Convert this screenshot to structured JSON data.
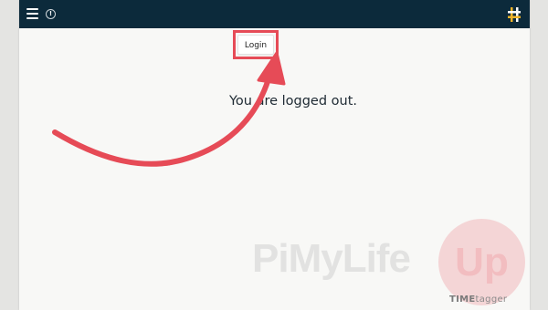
{
  "app": {
    "info_glyph": "!"
  },
  "header": {
    "menu_icon": "hamburger-menu-icon",
    "info_icon": "info-icon",
    "logo_icon": "timetagger-logo-icon"
  },
  "login_button": {
    "label": "Login"
  },
  "main": {
    "message": "You are logged out."
  },
  "watermark": {
    "text": "PiMyLife",
    "circle_text": "Up"
  },
  "badge": {
    "part1": "TIME",
    "part2": "tagger"
  },
  "colors": {
    "topbar": "#0c2a3b",
    "background": "#f8f8f6",
    "highlight": "#e64b57",
    "logo_accent": "#f0b429"
  }
}
